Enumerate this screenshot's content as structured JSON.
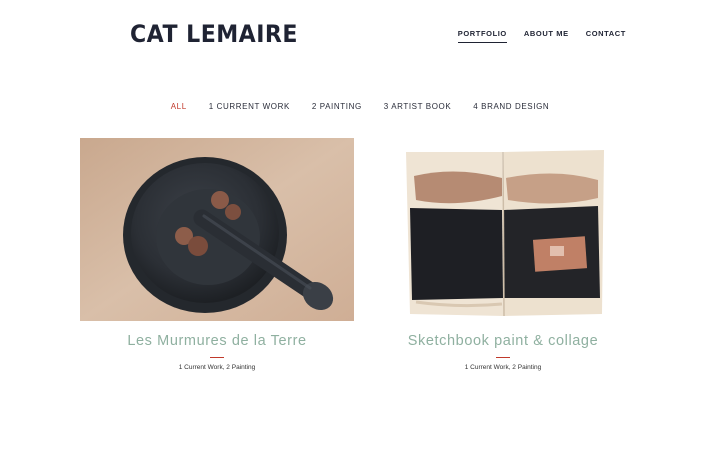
{
  "site": {
    "logo": "CAT LEMAIRE"
  },
  "nav": {
    "items": [
      {
        "label": "PORTFOLIO",
        "active": true
      },
      {
        "label": "ABOUT ME",
        "active": false
      },
      {
        "label": "CONTACT",
        "active": false
      }
    ]
  },
  "filters": [
    {
      "label": "ALL",
      "active": true
    },
    {
      "label": "1 CURRENT WORK",
      "active": false
    },
    {
      "label": "2 PAINTING",
      "active": false
    },
    {
      "label": "3 ARTIST BOOK",
      "active": false
    },
    {
      "label": "4 BRAND DESIGN",
      "active": false
    }
  ],
  "projects": [
    {
      "title": "Les Murmures de la Terre",
      "categories": "1 Current Work, 2 Painting"
    },
    {
      "title": "Sketchbook paint & collage",
      "categories": "1 Current Work, 2 Painting"
    }
  ],
  "colors": {
    "accent": "#c0392b",
    "title": "#8fb0a0",
    "text": "#1f2333"
  }
}
